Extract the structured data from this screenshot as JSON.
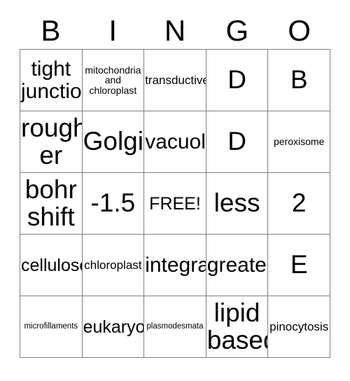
{
  "card": {
    "title_letters": [
      "B",
      "I",
      "N",
      "G",
      "O"
    ],
    "rows": [
      [
        {
          "text": "tight\njunction",
          "size": "fs-xxl"
        },
        {
          "text": "mitochondria\nand\nchloroplast",
          "size": "fs-sm"
        },
        {
          "text": "transductive",
          "size": "fs-md"
        },
        {
          "text": "D",
          "size": "fs-huge"
        },
        {
          "text": "B",
          "size": "fs-huge"
        }
      ],
      [
        {
          "text": "rough\ner",
          "size": "fs-huge"
        },
        {
          "text": "Golgi",
          "size": "fs-huge"
        },
        {
          "text": "vacuole",
          "size": "fs-xxl"
        },
        {
          "text": "D",
          "size": "fs-huge"
        },
        {
          "text": "peroxisome",
          "size": "fs-sm"
        }
      ],
      [
        {
          "text": "bohr\nshift",
          "size": "fs-huge"
        },
        {
          "text": "-1.5",
          "size": "fs-huge"
        },
        {
          "text": "FREE!",
          "size": "fs-xl"
        },
        {
          "text": "less",
          "size": "fs-huge"
        },
        {
          "text": "2",
          "size": "fs-huge"
        }
      ],
      [
        {
          "text": "cellulose",
          "size": "fs-xl"
        },
        {
          "text": "chloroplast",
          "size": "fs-md"
        },
        {
          "text": "integral",
          "size": "fs-xxl"
        },
        {
          "text": "greater",
          "size": "fs-xxl"
        },
        {
          "text": "E",
          "size": "fs-huge"
        }
      ],
      [
        {
          "text": "microfillaments",
          "size": "fs-xs"
        },
        {
          "text": "eukaryote",
          "size": "fs-xl"
        },
        {
          "text": "plasmodesmata",
          "size": "fs-xs"
        },
        {
          "text": "lipid\nbased",
          "size": "fs-huge"
        },
        {
          "text": "pinocytosis",
          "size": "fs-md"
        }
      ]
    ]
  },
  "colors": {
    "border": "#808080",
    "text": "#000000",
    "background": "#ffffff"
  }
}
